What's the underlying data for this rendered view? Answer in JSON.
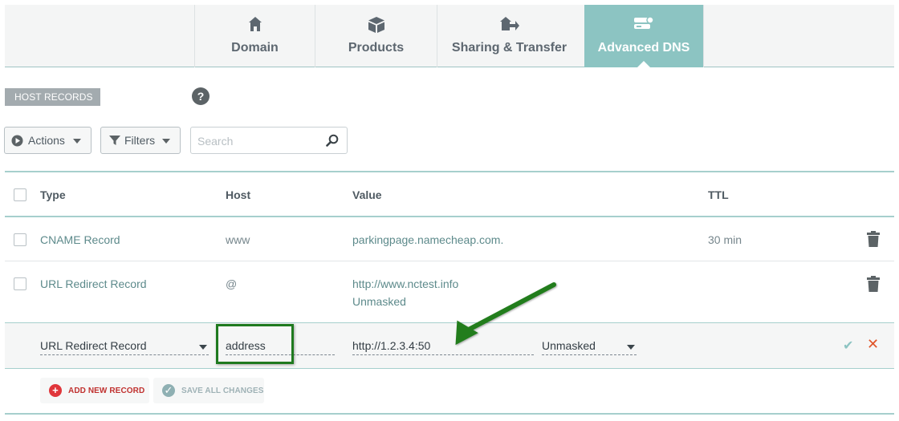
{
  "tabs": [
    {
      "label": "Domain",
      "icon": "home-icon",
      "active": false
    },
    {
      "label": "Products",
      "icon": "box-icon",
      "active": false
    },
    {
      "label": "Sharing & Transfer",
      "icon": "home-transfer-icon",
      "active": false
    },
    {
      "label": "Advanced DNS",
      "icon": "server-icon",
      "active": true
    }
  ],
  "section": {
    "label": "HOST RECORDS",
    "help": "?"
  },
  "toolbar": {
    "actions_label": "Actions",
    "filters_label": "Filters",
    "search_placeholder": "Search"
  },
  "table": {
    "columns": [
      "Type",
      "Host",
      "Value",
      "TTL"
    ],
    "rows": [
      {
        "type": "CNAME Record",
        "host": "www",
        "value": "parkingpage.namecheap.com.",
        "value2": "",
        "ttl": "30 min"
      },
      {
        "type": "URL Redirect Record",
        "host": "@",
        "value": "http://www.nctest.info",
        "value2": "Unmasked",
        "ttl": ""
      }
    ]
  },
  "edit_row": {
    "type": "URL Redirect Record",
    "host": "address",
    "value": "http://1.2.3.4:50",
    "mask": "Unmasked"
  },
  "buttons": {
    "add_new_record": "ADD NEW RECORD",
    "save_all_changes": "SAVE ALL CHANGES"
  },
  "colors": {
    "accent_teal": "#8cc4c2",
    "annotation_green": "#1f7a1f",
    "add_red": "#e0363b"
  }
}
